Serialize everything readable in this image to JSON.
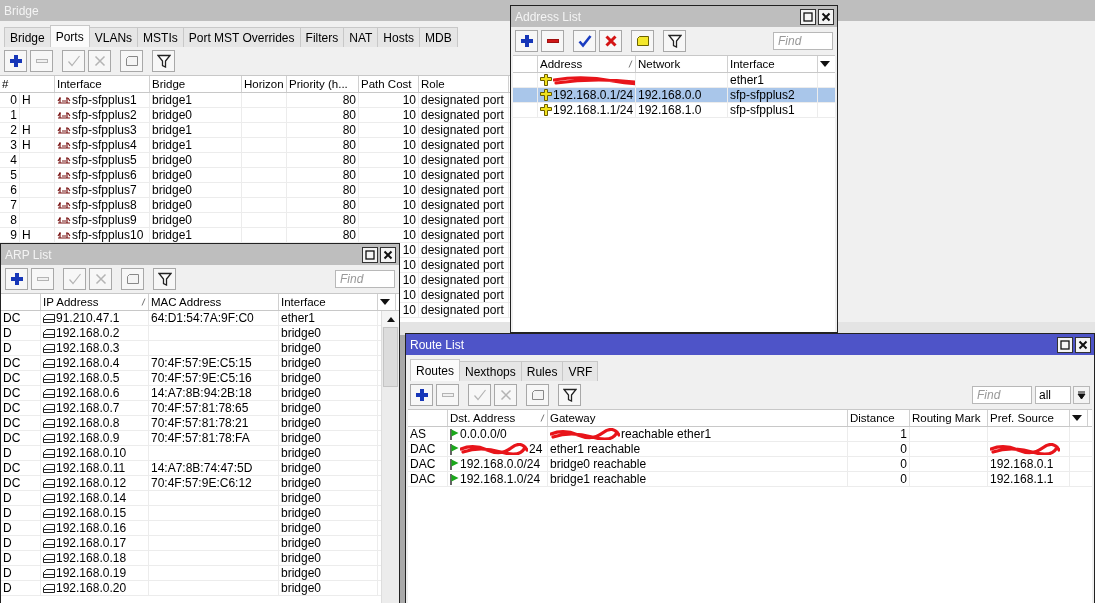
{
  "bridge_window": {
    "title": "Bridge",
    "active": false,
    "tabs": [
      {
        "label": "Bridge",
        "selected": false
      },
      {
        "label": "Ports",
        "selected": true
      },
      {
        "label": "VLANs",
        "selected": false
      },
      {
        "label": "MSTIs",
        "selected": false
      },
      {
        "label": "Port MST Overrides",
        "selected": false
      },
      {
        "label": "Filters",
        "selected": false
      },
      {
        "label": "NAT",
        "selected": false
      },
      {
        "label": "Hosts",
        "selected": false
      },
      {
        "label": "MDB",
        "selected": false
      }
    ],
    "toolbar": [
      {
        "kind": "add",
        "disabled": false
      },
      {
        "kind": "remove",
        "disabled": true
      },
      {
        "kind": "enable",
        "disabled": true
      },
      {
        "kind": "disable",
        "disabled": true
      },
      {
        "kind": "comment",
        "disabled": true
      },
      {
        "kind": "filter",
        "disabled": false
      }
    ],
    "columns": [
      {
        "label": "#",
        "sorted": false
      },
      {
        "label": "Interface",
        "sorted": false
      },
      {
        "label": "Bridge",
        "sorted": false
      },
      {
        "label": "Horizon",
        "sorted": false
      },
      {
        "label": "Priority (h...",
        "sorted": false
      },
      {
        "label": "Path Cost",
        "sorted": false
      },
      {
        "label": "Role",
        "sorted": false
      }
    ],
    "rows": [
      {
        "number": "0",
        "flag": "H",
        "interface": "sfp-sfpplus1",
        "bridge": "bridge1",
        "priority": "80",
        "path_cost": "10",
        "role": "designated port"
      },
      {
        "number": "1",
        "interface": "sfp-sfpplus2",
        "bridge": "bridge0",
        "priority": "80",
        "path_cost": "10",
        "role": "designated port"
      },
      {
        "number": "2",
        "flag": "H",
        "interface": "sfp-sfpplus3",
        "bridge": "bridge1",
        "priority": "80",
        "path_cost": "10",
        "role": "designated port"
      },
      {
        "number": "3",
        "flag": "H",
        "interface": "sfp-sfpplus4",
        "bridge": "bridge1",
        "priority": "80",
        "path_cost": "10",
        "role": "designated port"
      },
      {
        "number": "4",
        "interface": "sfp-sfpplus5",
        "bridge": "bridge0",
        "priority": "80",
        "path_cost": "10",
        "role": "designated port"
      },
      {
        "number": "5",
        "interface": "sfp-sfpplus6",
        "bridge": "bridge0",
        "priority": "80",
        "path_cost": "10",
        "role": "designated port"
      },
      {
        "number": "6",
        "interface": "sfp-sfpplus7",
        "bridge": "bridge0",
        "priority": "80",
        "path_cost": "10",
        "role": "designated port"
      },
      {
        "number": "7",
        "interface": "sfp-sfpplus8",
        "bridge": "bridge0",
        "priority": "80",
        "path_cost": "10",
        "role": "designated port"
      },
      {
        "number": "8",
        "interface": "sfp-sfpplus9",
        "bridge": "bridge0",
        "priority": "80",
        "path_cost": "10",
        "role": "designated port"
      },
      {
        "number": "9",
        "flag": "H",
        "interface": "sfp-sfpplus10",
        "bridge": "bridge1",
        "priority": "80",
        "path_cost": "10",
        "role": "designated port"
      },
      {
        "path_cost": "10",
        "role": "designated port"
      },
      {
        "path_cost": "10",
        "role": "designated port"
      },
      {
        "path_cost": "10",
        "role": "designated port"
      },
      {
        "path_cost": "10",
        "role": "designated port"
      },
      {
        "path_cost": "10",
        "role": "designated port"
      }
    ]
  },
  "address_window": {
    "title": "Address List",
    "active": false,
    "toolbar": [
      {
        "kind": "add",
        "disabled": false
      },
      {
        "kind": "remove",
        "disabled": false
      },
      {
        "kind": "enable",
        "disabled": false
      },
      {
        "kind": "disable",
        "disabled": false
      },
      {
        "kind": "comment",
        "disabled": false
      },
      {
        "kind": "filter",
        "disabled": false
      }
    ],
    "find_placeholder": "Find",
    "columns": [
      {
        "label": "Address",
        "sorted": true
      },
      {
        "label": "Network",
        "sorted": false
      },
      {
        "label": "Interface",
        "sorted": false
      }
    ],
    "rows": [
      {
        "interface": "ether1",
        "selected": false,
        "address_redacted": true
      },
      {
        "address": "192.168.0.1/24",
        "network": "192.168.0.0",
        "interface": "sfp-sfpplus2",
        "selected": true
      },
      {
        "address": "192.168.1.1/24",
        "network": "192.168.1.0",
        "interface": "sfp-sfpplus1",
        "selected": false
      }
    ]
  },
  "arp_window": {
    "title": "ARP List",
    "active": false,
    "toolbar": [
      {
        "kind": "add",
        "disabled": false
      },
      {
        "kind": "remove",
        "disabled": true
      },
      {
        "kind": "enable",
        "disabled": true
      },
      {
        "kind": "disable",
        "disabled": true
      },
      {
        "kind": "comment",
        "disabled": true
      },
      {
        "kind": "filter",
        "disabled": false
      }
    ],
    "find_placeholder": "Find",
    "columns": [
      {
        "label": "IP Address",
        "sorted": true
      },
      {
        "label": "MAC Address",
        "sorted": false
      },
      {
        "label": "Interface",
        "sorted": false
      }
    ],
    "rows": [
      {
        "flags": "DC",
        "ip": "91.210.47.1",
        "mac": "64:D1:54:7A:9F:C0",
        "interface": "ether1"
      },
      {
        "flags": "D",
        "ip": "192.168.0.2",
        "interface": "bridge0"
      },
      {
        "flags": "D",
        "ip": "192.168.0.3",
        "interface": "bridge0"
      },
      {
        "flags": "DC",
        "ip": "192.168.0.4",
        "mac": "70:4F:57:9E:C5:15",
        "interface": "bridge0"
      },
      {
        "flags": "DC",
        "ip": "192.168.0.5",
        "mac": "70:4F:57:9E:C5:16",
        "interface": "bridge0"
      },
      {
        "flags": "DC",
        "ip": "192.168.0.6",
        "mac": "14:A7:8B:94:2B:18",
        "interface": "bridge0"
      },
      {
        "flags": "DC",
        "ip": "192.168.0.7",
        "mac": "70:4F:57:81:78:65",
        "interface": "bridge0"
      },
      {
        "flags": "DC",
        "ip": "192.168.0.8",
        "mac": "70:4F:57:81:78:21",
        "interface": "bridge0"
      },
      {
        "flags": "DC",
        "ip": "192.168.0.9",
        "mac": "70:4F:57:81:78:FA",
        "interface": "bridge0"
      },
      {
        "flags": "D",
        "ip": "192.168.0.10",
        "interface": "bridge0"
      },
      {
        "flags": "DC",
        "ip": "192.168.0.11",
        "mac": "14:A7:8B:74:47:5D",
        "interface": "bridge0"
      },
      {
        "flags": "DC",
        "ip": "192.168.0.12",
        "mac": "70:4F:57:9E:C6:12",
        "interface": "bridge0"
      },
      {
        "flags": "D",
        "ip": "192.168.0.14",
        "interface": "bridge0"
      },
      {
        "flags": "D",
        "ip": "192.168.0.15",
        "interface": "bridge0"
      },
      {
        "flags": "D",
        "ip": "192.168.0.16",
        "interface": "bridge0"
      },
      {
        "flags": "D",
        "ip": "192.168.0.17",
        "interface": "bridge0"
      },
      {
        "flags": "D",
        "ip": "192.168.0.18",
        "interface": "bridge0"
      },
      {
        "flags": "D",
        "ip": "192.168.0.19",
        "interface": "bridge0"
      },
      {
        "flags": "D",
        "ip": "192.168.0.20",
        "interface": "bridge0"
      }
    ]
  },
  "route_window": {
    "title": "Route List",
    "active": true,
    "tabs": [
      {
        "label": "Routes",
        "selected": true
      },
      {
        "label": "Nexthops",
        "selected": false
      },
      {
        "label": "Rules",
        "selected": false
      },
      {
        "label": "VRF",
        "selected": false
      }
    ],
    "toolbar": [
      {
        "kind": "add",
        "disabled": false
      },
      {
        "kind": "remove",
        "disabled": true
      },
      {
        "kind": "enable",
        "disabled": true
      },
      {
        "kind": "disable",
        "disabled": true
      },
      {
        "kind": "comment",
        "disabled": true
      },
      {
        "kind": "filter",
        "disabled": false
      }
    ],
    "find_placeholder": "Find",
    "filter_value": "all",
    "columns": [
      {
        "label": "Dst. Address",
        "sorted": true
      },
      {
        "label": "Gateway",
        "sorted": false
      },
      {
        "label": "Distance",
        "sorted": false
      },
      {
        "label": "Routing Mark",
        "sorted": false
      },
      {
        "label": "Pref. Source",
        "sorted": false
      }
    ],
    "rows": [
      {
        "flags": "AS",
        "dst_address": "0.0.0.0/0",
        "gateway": "reachable ether1",
        "distance": "1",
        "gateway_redacted": true
      },
      {
        "flags": "DAC",
        "dst_address": "24",
        "gateway": "ether1 reachable",
        "distance": "0",
        "dst_address_redacted": true,
        "pref_source_redacted": true
      },
      {
        "flags": "DAC",
        "dst_address": "192.168.0.0/24",
        "gateway": "bridge0 reachable",
        "distance": "0",
        "pref_source": "192.168.0.1"
      },
      {
        "flags": "DAC",
        "dst_address": "192.168.1.0/24",
        "gateway": "bridge1 reachable",
        "distance": "0",
        "pref_source": "192.168.1.1"
      }
    ]
  }
}
